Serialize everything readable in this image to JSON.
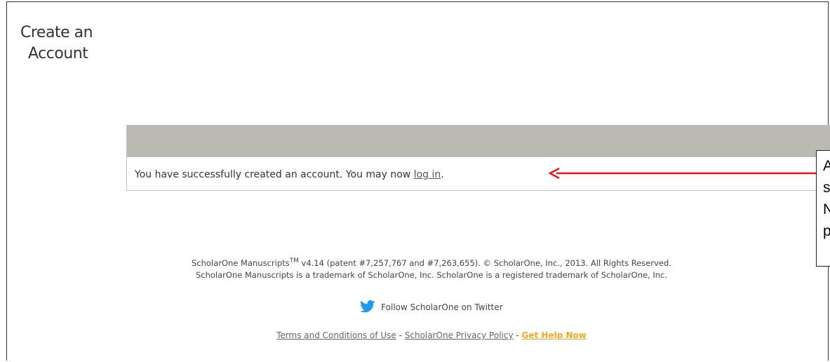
{
  "page": {
    "title_line1": "Create an",
    "title_line2": "Account"
  },
  "panel": {
    "message_prefix": "You have successfully created an account. You may now ",
    "login_link": "log in",
    "message_suffix": "."
  },
  "callout": {
    "lines": [
      "A",
      "s",
      "N",
      "p"
    ]
  },
  "footer": {
    "line1_a": "ScholarOne Manuscripts",
    "line1_tm": "TM",
    "line1_b": " v4.14 (patent #7,257,767 and #7,263,655). © ScholarOne, Inc., 2013. All Rights Reserved.",
    "line2": "ScholarOne Manuscripts is a trademark of ScholarOne, Inc. ScholarOne is a registered trademark of ScholarOne, Inc.",
    "twitter": "Follow ScholarOne on Twitter",
    "terms": "Terms and Conditions of Use",
    "privacy": "ScholarOne Privacy Policy",
    "help": "Get Help Now",
    "separator": " - "
  },
  "colors": {
    "panel_header": "#bbbab2",
    "arrow": "#e8141c",
    "help_link": "#f5a623",
    "twitter_bird": "#1d9bf0"
  }
}
